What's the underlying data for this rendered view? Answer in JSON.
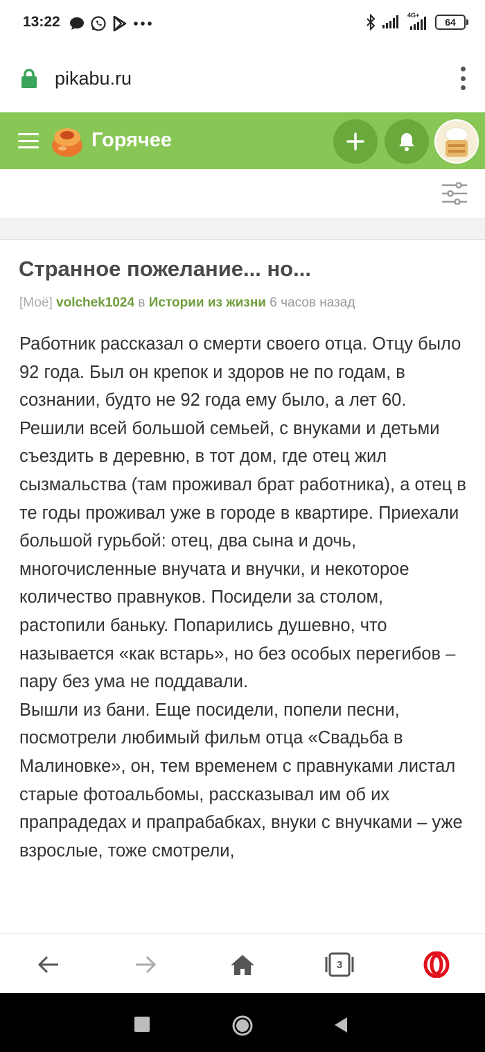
{
  "status_bar": {
    "time": "13:22",
    "network": "4G+",
    "battery": "64"
  },
  "browser": {
    "url": "pikabu.ru",
    "tabs_count": "3"
  },
  "app_header": {
    "title": "Горячее",
    "accent_color": "#88c656"
  },
  "post": {
    "title": "Странное пожелание... но...",
    "meta": {
      "tag": "[Моё]",
      "author": "volchek1024",
      "in_word": "в",
      "community": "Истории из жизни",
      "time_ago": "6 часов назад"
    },
    "paragraphs": [
      "Работник рассказал о смерти своего отца. Отцу было 92 года. Был он крепок и здоров не по годам, в сознании, будто не 92 года ему было, а лет 60.",
      "Решили всей большой семьей, с внуками и детьми съездить в деревню, в тот дом, где отец жил сызмальства (там проживал брат работника), а отец в те годы проживал уже в городе в квартире. Приехали большой гурьбой: отец, два сына и дочь, многочисленные внучата и внучки, и некоторое количество правнуков. Посидели за столом, растопили баньку. Попарились душевно, что называется «как встарь», но без особых перегибов – пару без ума не поддавали.",
      "Вышли из бани. Еще посидели, попели песни, посмотрели любимый фильм отца «Свадьба в Малиновке», он, тем временем с правнуками листал старые фотоальбомы, рассказывал им об их прапрадедах и прапрабабках, внуки с внучками – уже взрослые, тоже смотрели,"
    ]
  },
  "icons": [
    "bluetooth-icon",
    "signal-icon",
    "lock-icon",
    "menu-icon",
    "plus-icon",
    "bell-icon",
    "filter-icon",
    "back-icon",
    "forward-icon",
    "home-icon",
    "tabs-icon",
    "opera-icon"
  ]
}
